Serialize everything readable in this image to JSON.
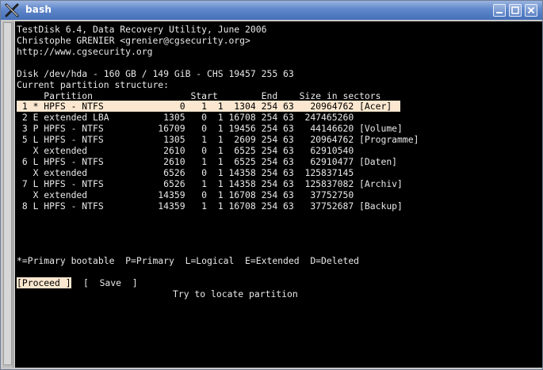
{
  "window": {
    "title": "bash"
  },
  "header": {
    "line1": "TestDisk 6.4, Data Recovery Utility, June 2006",
    "line2": "Christophe GRENIER <grenier@cgsecurity.org>",
    "line3": "http://www.cgsecurity.org"
  },
  "disk": {
    "info": "Disk /dev/hda - 160 GB / 149 GiB - CHS 19457 255 63",
    "structure_label": "Current partition structure:"
  },
  "table": {
    "header": "     Partition                  Start        End    Size in sectors",
    "rows": [
      " 1 * HPFS - NTFS              0   1  1  1304 254 63   20964762 [Acer]",
      " 2 E extended LBA          1305   0  1 16708 254 63  247465260",
      " 3 P HPFS - NTFS          16709   0  1 19456 254 63   44146620 [Volume]",
      " 5 L HPFS - NTFS           1305   1  1  2609 254 63   20964762 [Programme]",
      "   X extended              2610   0  1  6525 254 63   62910540",
      " 6 L HPFS - NTFS           2610   1  1  6525 254 63   62910477 [Daten]",
      "   X extended              6526   0  1 14358 254 63  125837145",
      " 7 L HPFS - NTFS           6526   1  1 14358 254 63  125837082 [Archiv]",
      "   X extended             14359   0  1 16708 254 63   37752750",
      " 8 L HPFS - NTFS          14359   1  1 16708 254 63   37752687 [Backup]"
    ]
  },
  "legend": "*=Primary bootable  P=Primary  L=Logical  E=Extended  D=Deleted",
  "actions": {
    "proceed": "[Proceed ]",
    "save": "[  Save  ]"
  },
  "status": "Try to locate partition",
  "colors": {
    "titlebar": "#5f87cb",
    "terminal_bg": "#000000",
    "terminal_fg": "#e8e8e8",
    "highlight": "#fbe7cf"
  },
  "icons": {
    "app": "x-icon",
    "minimize": "minimize-icon",
    "maximize": "maximize-icon",
    "close": "close-icon"
  }
}
